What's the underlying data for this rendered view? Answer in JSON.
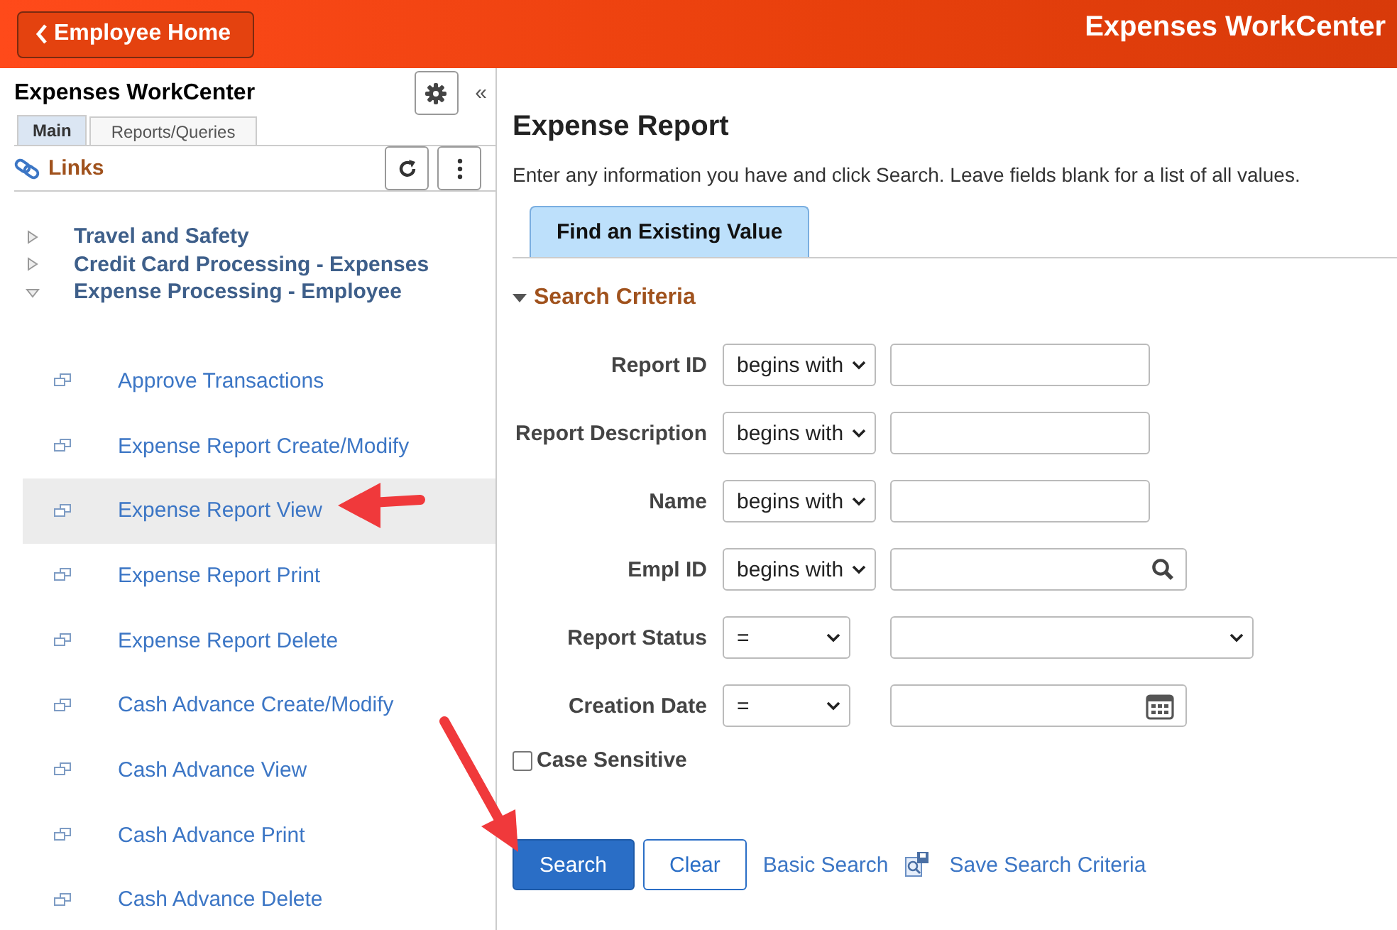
{
  "header": {
    "back_button": "Employee Home",
    "title": "Expenses WorkCenter"
  },
  "sidebar": {
    "title": "Expenses WorkCenter",
    "collapse": "«",
    "tabs": [
      {
        "label": "Main",
        "selected": true
      },
      {
        "label": "Reports/Queries",
        "selected": false
      }
    ],
    "section_title": "Links",
    "tree": [
      {
        "label": "Travel and Safety",
        "expanded": false
      },
      {
        "label": "Credit Card Processing - Expenses",
        "expanded": false
      },
      {
        "label": "Expense Processing - Employee",
        "expanded": true,
        "children": [
          {
            "label": "Approve Transactions",
            "selected": false
          },
          {
            "label": "Expense Report Create/Modify",
            "selected": false
          },
          {
            "label": "Expense Report View",
            "selected": true
          },
          {
            "label": "Expense Report Print",
            "selected": false
          },
          {
            "label": "Expense Report Delete",
            "selected": false
          },
          {
            "label": "Cash Advance Create/Modify",
            "selected": false
          },
          {
            "label": "Cash Advance View",
            "selected": false
          },
          {
            "label": "Cash Advance Print",
            "selected": false
          },
          {
            "label": "Cash Advance Delete",
            "selected": false
          }
        ]
      }
    ]
  },
  "main": {
    "title": "Expense Report",
    "instructions": "Enter any information you have and click Search. Leave fields blank for a list of all values.",
    "tabs": [
      {
        "label": "Find an Existing Value",
        "selected": true
      }
    ],
    "section": {
      "title": "Search Criteria",
      "expanded": true
    },
    "fields": [
      {
        "label": "Report ID",
        "operator": "begins with",
        "kind": "text"
      },
      {
        "label": "Report Description",
        "operator": "begins with",
        "kind": "text"
      },
      {
        "label": "Name",
        "operator": "begins with",
        "kind": "text"
      },
      {
        "label": "Empl ID",
        "operator": "begins with",
        "kind": "lookup"
      },
      {
        "label": "Report Status",
        "operator": "=",
        "kind": "select"
      },
      {
        "label": "Creation Date",
        "operator": "=",
        "kind": "date"
      }
    ],
    "case_sensitive": {
      "label": "Case Sensitive",
      "checked": false
    },
    "actions": [
      {
        "label": "Search",
        "kind": "primary"
      },
      {
        "label": "Clear",
        "kind": "secondary"
      },
      {
        "label": "Basic Search",
        "kind": "link"
      },
      {
        "label": "Save Search Criteria",
        "kind": "icon-link"
      }
    ]
  }
}
